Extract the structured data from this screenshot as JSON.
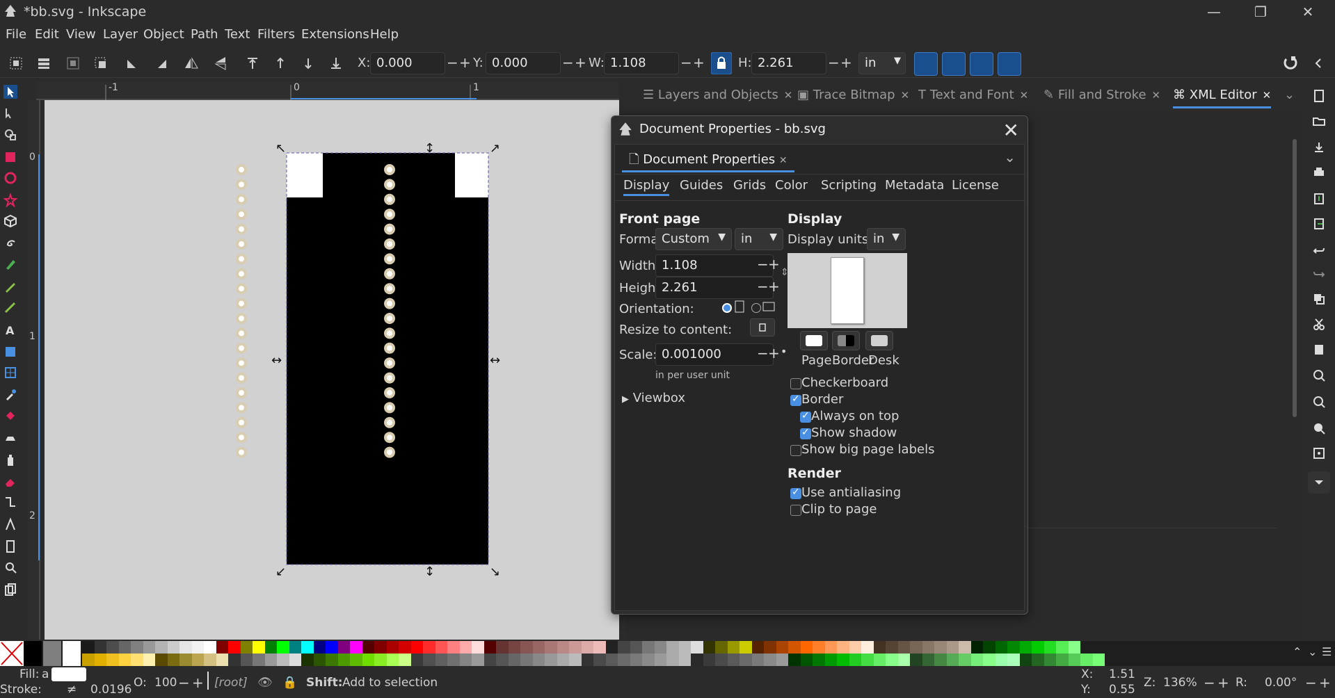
{
  "window": {
    "title": "*bb.svg - Inkscape"
  },
  "menu": [
    "File",
    "Edit",
    "View",
    "Layer",
    "Object",
    "Path",
    "Text",
    "Filters",
    "Extensions",
    "Help"
  ],
  "toolbar": {
    "x_label": "X:",
    "x_value": "0.000",
    "y_label": "Y:",
    "y_value": "0.000",
    "w_label": "W:",
    "w_value": "1.108",
    "h_label": "H:",
    "h_value": "2.261",
    "unit": "in"
  },
  "ruler": {
    "h_labels": [
      "-1",
      "0",
      "1"
    ],
    "v_labels": [
      "0",
      "1",
      "2"
    ]
  },
  "dock_tabs": [
    "Layers and Objects",
    "Trace Bitmap",
    "Text and Font",
    "Fill and Stroke",
    "XML Editor"
  ],
  "dialog": {
    "title": "Document Properties - bb.svg",
    "tab": "Document Properties",
    "subtabs": [
      "Display",
      "Guides",
      "Grids",
      "Color",
      "Scripting",
      "Metadata",
      "License"
    ],
    "front_page_title": "Front page",
    "format_label": "Format:",
    "format_value": "Custom",
    "format_unit": "in",
    "width_label": "Width:",
    "width_value": "1.108",
    "height_label": "Height:",
    "height_value": "2.261",
    "orientation_label": "Orientation:",
    "resize_label": "Resize to content:",
    "scale_label": "Scale:",
    "scale_value": "0.001000",
    "scale_note": "in per user unit",
    "viewbox_label": "Viewbox",
    "display_title": "Display",
    "display_units_label": "Display units:",
    "display_units_value": "in",
    "color_labels": [
      "Page",
      "Border",
      "Desk"
    ],
    "checkboxes": [
      {
        "label": "Checkerboard",
        "checked": false
      },
      {
        "label": "Border",
        "checked": true
      },
      {
        "label": "Always on top",
        "checked": true
      },
      {
        "label": "Show shadow",
        "checked": true
      },
      {
        "label": "Show big page labels",
        "checked": false
      }
    ],
    "render_title": "Render",
    "render_checkboxes": [
      {
        "label": "Use antialiasing",
        "checked": true
      },
      {
        "label": "Clip to page",
        "checked": false
      }
    ]
  },
  "status": {
    "fill_label": "Fill:",
    "fill_value": "a",
    "stroke_label": "Stroke:",
    "stroke_value": "0.0196",
    "opacity_label": "O:",
    "opacity_value": "100",
    "layer": "[root]",
    "message_bold": "Shift:",
    "message": "Add to selection",
    "x_label": "X:",
    "x_value": "1.51",
    "y_label": "Y:",
    "y_value": "0.55",
    "zoom_label": "Z:",
    "zoom_value": "136%",
    "rotate_label": "R:",
    "rotate_value": "0.00°"
  }
}
